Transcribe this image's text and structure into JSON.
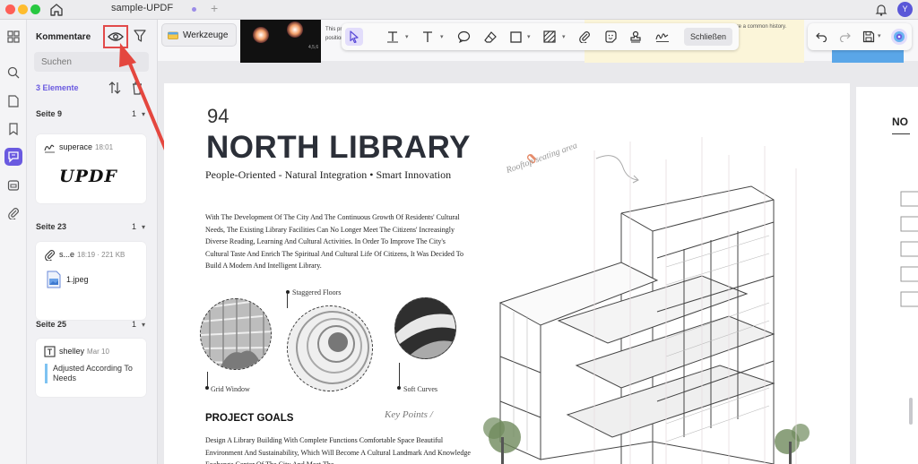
{
  "window": {
    "doc_tab": "sample-UPDF",
    "new_tab": "+",
    "avatar_initial": "Y"
  },
  "panel": {
    "title": "Kommentare",
    "search_placeholder": "Suchen",
    "count_label": "3 Elemente",
    "sections": [
      {
        "label": "Seite 9",
        "count": "1"
      },
      {
        "label": "Seite 23",
        "count": "1"
      },
      {
        "label": "Seite 25",
        "count": "1"
      }
    ],
    "cards": [
      {
        "author": "superace",
        "time": "18:01",
        "signature": "UPDF"
      },
      {
        "author": "s...e",
        "time": "18:19 · 221 KB",
        "file": "1.jpeg"
      },
      {
        "author": "shelley",
        "time": "Mar 10",
        "note": "Adjusted According To Needs"
      }
    ]
  },
  "toolbar": {
    "werkzeuge": "Werkzeuge",
    "schliessen": "Schließen",
    "thumb_label": "4,5,6",
    "thumb_text_1": "This prote",
    "thumb_text_2": "positions.",
    "yellow_text": "share a common history."
  },
  "page": {
    "number": "94",
    "title": "NORTH LIBRARY",
    "subtitle": "People-Oriented - Natural Integration • Smart Innovation",
    "body": "With The Development Of The City And The Continuous Growth Of Residents' Cultural Needs, The Existing Library Facilities Can No Longer Meet The Citizens' Increasingly Diverse Reading, Learning And Cultural Activities. In Order To Improve The City's Cultural Taste And Enrich The Spiritual And Cultural Life Of Citizens, It Was Decided To Build A Modern And Intelligent Library.",
    "cap_staggered": "Staggered Floors",
    "cap_grid": "Grid Window",
    "cap_soft": "Soft Curves",
    "rooftop": "Rooftop seating area",
    "goals_title": "PROJECT GOALS",
    "key_points": "Key Points /",
    "goals_body": "Design A Library Building With Complete Functions Comfortable Space Beautiful Environment And Sustainability, Which Will Become A Cultural Landmark And Knowledge Exchange Center Of The City And Meet The"
  },
  "page2": {
    "title": "NO"
  },
  "colors": {
    "accent": "#6a5ae0",
    "highlight_box": "#e24a4a",
    "note_bar": "#7ec3f2"
  }
}
